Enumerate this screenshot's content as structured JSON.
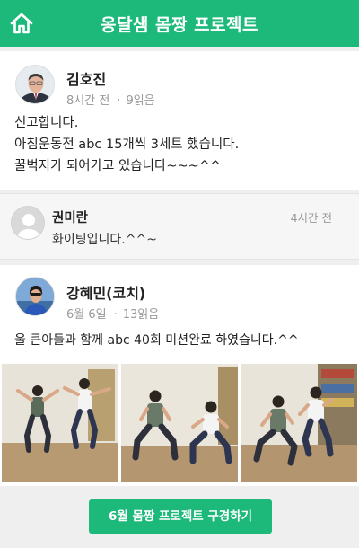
{
  "header": {
    "title": "옹달샘 몸짱 프로젝트",
    "home_icon": "home-icon"
  },
  "posts": [
    {
      "author": "김호진",
      "time": "8시간 전",
      "views": "9읽음",
      "text": "신고합니다.\n아침운동전 abc 15개씩 3세트 했습니다.\n꿀벅지가 되어가고 있습니다~~~^^"
    },
    {
      "author": "강혜민(코치)",
      "time": "6월 6일",
      "views": "13읽음",
      "text": "울 큰아들과 함께 abc 40회 미션완료 하였습니다.^^"
    }
  ],
  "comment": {
    "author": "권미란",
    "time": "4시간 전",
    "text": "화이팅입니다.^^~"
  },
  "cta_label": "6월 몸짱 프로젝트 구경하기",
  "colors": {
    "accent": "#1db97a",
    "background": "#efefef"
  }
}
